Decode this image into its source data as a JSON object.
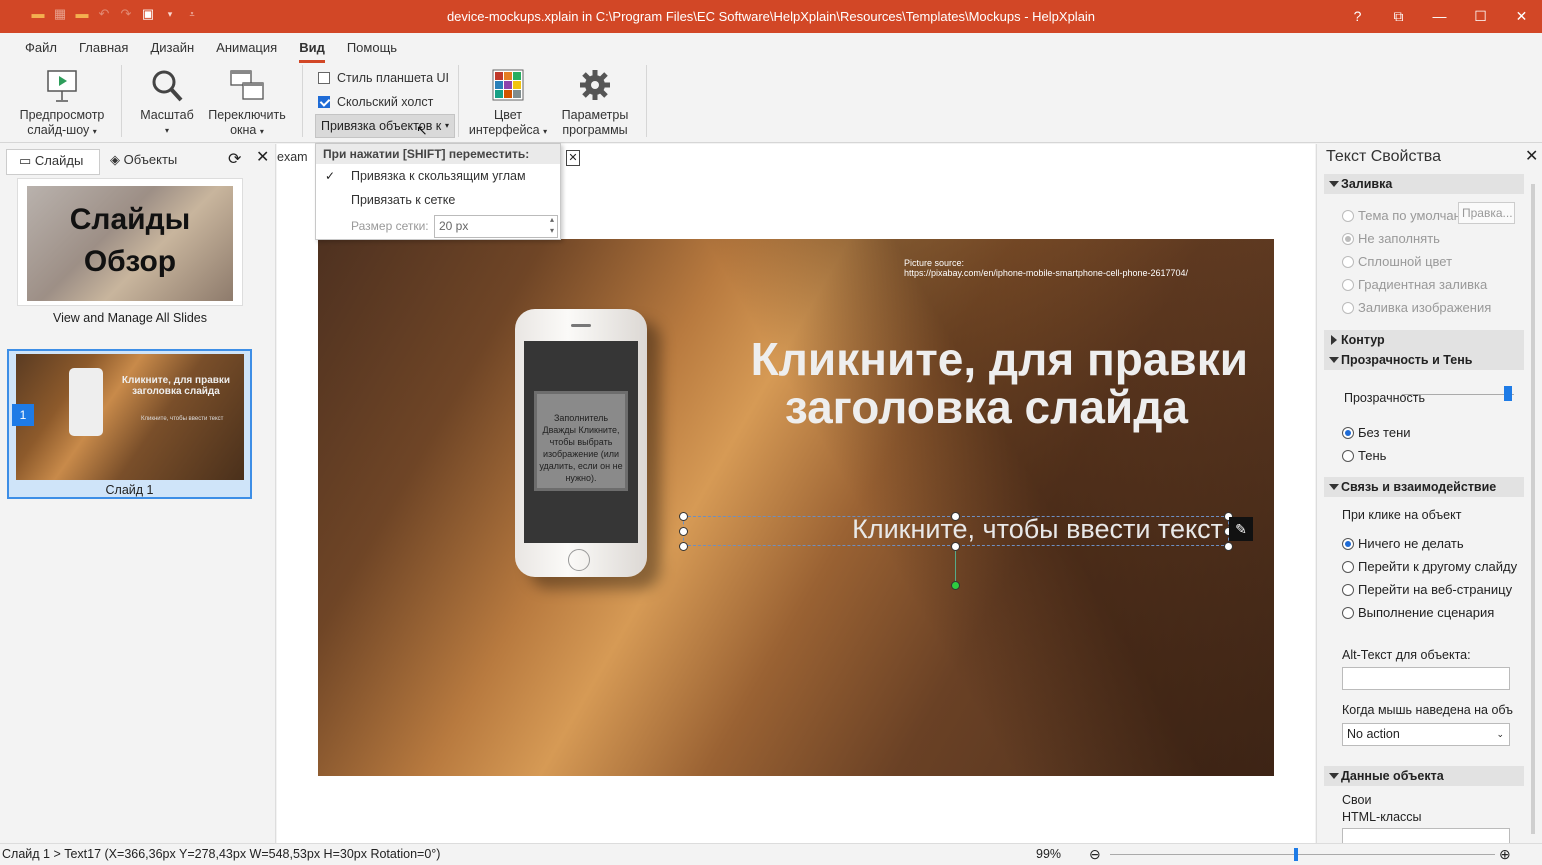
{
  "window": {
    "title": "device-mockups.xplain in C:\\Program Files\\EC Software\\HelpXplain\\Resources\\Templates\\Mockups - HelpXplain",
    "help_btn": "?",
    "restore_btn": "⧉",
    "minimize_btn": "—",
    "maximize_btn": "☐",
    "close_btn": "✕"
  },
  "menu": {
    "tabs": [
      "Файл",
      "Главная",
      "Дизайн",
      "Анимация",
      "Вид",
      "Помощь"
    ]
  },
  "ribbon": {
    "preview_label1": "Предпросмотр",
    "preview_label2": "слайд-шоу",
    "zoom_label": "Масштаб",
    "switch_label1": "Переключить",
    "switch_label2": "окна",
    "tablet_ui": "Стиль планшета UI",
    "sliding_canvas": "Скольский холст",
    "snap_btn": "Привязка объектов к",
    "color_label1": "Цвет",
    "color_label2": "интерфейса",
    "settings_label1": "Параметры",
    "settings_label2": "программы"
  },
  "snap_menu": {
    "header": "При нажатии [SHIFT] переместить:",
    "item1": "Привязка к скользящим углам",
    "item2": "Привязать к сетке",
    "grid_label": "Размер сетки:",
    "grid_value": "20 px"
  },
  "left_panel": {
    "tab_slides": "Слайды",
    "tab_objects": "Объекты",
    "overview_line1": "Слайды",
    "overview_line2": "Обзор",
    "overview_caption": "View and Manage All Slides",
    "slide1_number": "1",
    "slide1_caption": "Слайд 1",
    "thumb_title": "Кликните, для правки заголовка слайда",
    "thumb_sub": "Кликните, чтобы ввести текст"
  },
  "doc_tab": "exam",
  "slide": {
    "source_line1": "Picture source:",
    "source_line2": "https://pixabay.com/en/iphone-mobile-smartphone-cell-phone-2617704/",
    "title_line1": "Кликните, для правки",
    "title_line2": "заголовка слайда",
    "subtitle": "Кликните, чтобы ввести текст",
    "placeholder": "Заполнитель Дважды Кликните, чтобы выбрать изображение (или удалить, если он не нужно)."
  },
  "right_panel": {
    "title": "Текст Свойства",
    "fill_section": "Заливка",
    "fill_options": [
      "Тема по умолчан",
      "Не заполнять",
      "Сплошной цвет",
      "Градиентная заливка",
      "Заливка изображения"
    ],
    "edit_btn": "Правка...",
    "contour_section": "Контур",
    "transp_section": "Прозрачность и Тень",
    "transp_label": "Прозрачность",
    "no_shadow": "Без тени",
    "shadow": "Тень",
    "link_section": "Связь и взаимодействие",
    "click_label": "При клике на объект",
    "click_options": [
      "Ничего не делать",
      "Перейти к другому слайду",
      "Перейти на веб-страницу",
      "Выполнение сценария"
    ],
    "alt_label": "Alt-Текст для объекта:",
    "hover_label": "Когда мышь наведена на объ",
    "hover_value": "No action",
    "data_section": "Данные объекта",
    "css_label1": "Свои",
    "css_label2": "HTML-классы"
  },
  "status": {
    "text": "Слайд 1 > Text17 (X=366,36px  Y=278,43px  W=548,53px  H=30px  Rotation=0°)",
    "zoom": "99%"
  },
  "colors": {
    "accent": "#d24726",
    "selection": "#3d8ee6",
    "checkbox": "#1e6bd6"
  }
}
